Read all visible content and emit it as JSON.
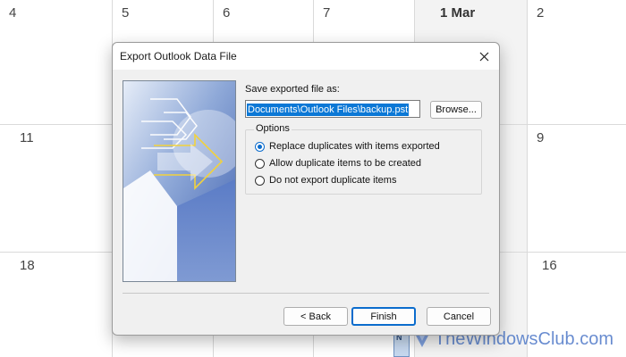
{
  "calendar": {
    "row1": [
      "4",
      "5",
      "6",
      "7",
      "1 Mar",
      "2"
    ],
    "row2": [
      "11",
      "9"
    ],
    "row3": [
      "18",
      "16"
    ],
    "event_strip_label": "N"
  },
  "dialog": {
    "title": "Export Outlook Data File",
    "save_label": "Save exported file as:",
    "path_value": "Documents\\Outlook Files\\backup.pst",
    "browse_label": "Browse...",
    "options_legend": "Options",
    "options": [
      {
        "label": "Replace duplicates with items exported",
        "checked": true
      },
      {
        "label": "Allow duplicate items to be created",
        "checked": false
      },
      {
        "label": "Do not export duplicate items",
        "checked": false
      }
    ],
    "buttons": {
      "back": "< Back",
      "finish": "Finish",
      "cancel": "Cancel"
    }
  },
  "watermark": "TheWindowsClub.com",
  "colors": {
    "accent": "#0b6ccd",
    "selection": "#0b78d6",
    "dialog_bg": "#f0f0f0"
  }
}
